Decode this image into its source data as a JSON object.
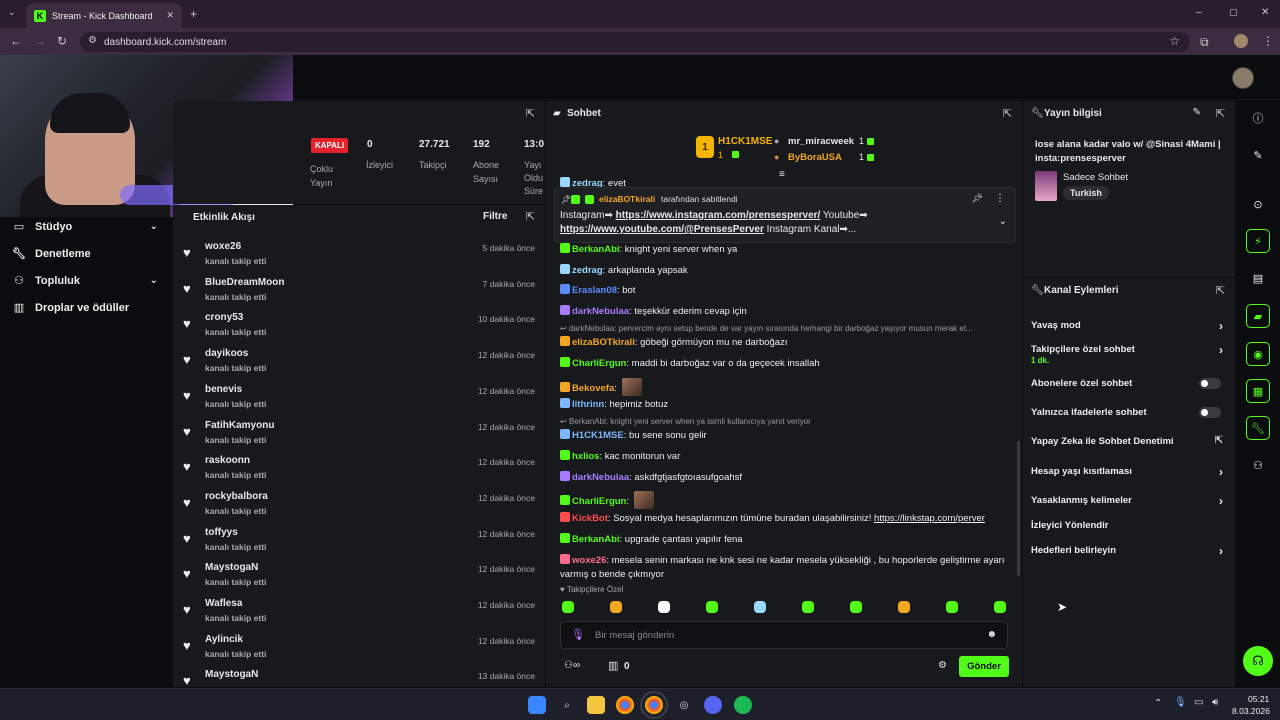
{
  "browser": {
    "tab_title": "Stream - Kick Dashboard",
    "new_tab": "+",
    "url": "dashboard.kick.com/stream",
    "window_controls": [
      "–",
      "▢",
      "✕"
    ]
  },
  "sidebar": {
    "items": [
      {
        "label": "Stüdyo",
        "icon": "tv-icon",
        "chevron": true
      },
      {
        "label": "Denetleme",
        "icon": "wrench-icon",
        "chevron": false
      },
      {
        "label": "Topluluk",
        "icon": "people-icon",
        "chevron": true
      },
      {
        "label": "Droplar ve ödüller",
        "icon": "gift-icon",
        "chevron": false
      }
    ]
  },
  "stats": {
    "status_badge": "KAPALI",
    "status_label_1": "Çoklu",
    "status_label_2": "Yayın",
    "viewers_value": "0",
    "viewers_label": "İzleyici",
    "followers_value": "27.721",
    "followers_label": "Takipçi",
    "subs_value": "192",
    "subs_label_1": "Abone",
    "subs_label_2": "Sayısı",
    "duration_value": "13:0",
    "duration_label_1": "Yayı",
    "duration_label_2": "Oldu",
    "duration_label_3": "Süre"
  },
  "activity": {
    "title": "Etkinlik Akışı",
    "filter_label": "Filtre",
    "items": [
      {
        "name": "woxe26",
        "sub": "kanalı takip etti",
        "time": "5 dakika önce"
      },
      {
        "name": "BlueDreamMoon",
        "sub": "kanalı takip etti",
        "time": "7 dakika önce"
      },
      {
        "name": "crony53",
        "sub": "kanalı takip etti",
        "time": "10 dakika önce"
      },
      {
        "name": "dayikoos",
        "sub": "kanalı takip etti",
        "time": "12 dakika önce"
      },
      {
        "name": "benevis",
        "sub": "kanalı takip etti",
        "time": "12 dakika önce"
      },
      {
        "name": "FatihKamyonu",
        "sub": "kanalı takip etti",
        "time": "12 dakika önce"
      },
      {
        "name": "raskoonn",
        "sub": "kanalı takip etti",
        "time": "12 dakika önce"
      },
      {
        "name": "rockybalbora",
        "sub": "kanalı takip etti",
        "time": "12 dakika önce"
      },
      {
        "name": "toffyys",
        "sub": "kanalı takip etti",
        "time": "12 dakika önce"
      },
      {
        "name": "MaystogaN",
        "sub": "kanalı takip etti",
        "time": "12 dakika önce"
      },
      {
        "name": "Waflesa",
        "sub": "kanalı takip etti",
        "time": "12 dakika önce"
      },
      {
        "name": "Aylincik",
        "sub": "kanalı takip etti",
        "time": "12 dakika önce"
      },
      {
        "name": "MaystogaN",
        "sub": "",
        "time": "13 dakika önce"
      }
    ]
  },
  "chat": {
    "title": "Sohbet",
    "top_gifters": [
      {
        "rank": "1",
        "name": "H1CK1MSE",
        "count": "1"
      },
      {
        "name": "mr_miracweek",
        "count": "1"
      },
      {
        "name": "ByBoraUSA",
        "count": "1"
      }
    ],
    "pinned": {
      "by_user": "elizaBOTkirali",
      "by_suffix": "tarafından sabitlendi",
      "line1_prefix": "Instagram➡",
      "line1_link": "https://www.instagram.com/prensesperver/",
      "line1_suffix": "Youtube➡",
      "line2_link": "https://www.youtube.com/@PrensesPerver",
      "line2_suffix": "Instagram Kanal➡..."
    },
    "messages": [
      {
        "user": "zedrag",
        "text": "evet",
        "color": "#9ad8ff",
        "partial": true
      },
      {
        "user": "BerkanAbi",
        "text": "knight yeni server when ya",
        "color": "#53fc18",
        "partial": true
      },
      {
        "user": "zedrag",
        "text": "arkaplanda yapsak",
        "color": "#9ad8ff"
      },
      {
        "user": "Eraslan08",
        "text": "bot",
        "color": "#5b8cff"
      },
      {
        "user": "darkNebulaa",
        "text": "teşekkür ederim cevap için",
        "color": "#a87cff"
      },
      {
        "reply": "darkNebulaa: pervercim aynı setup bende de var yayın sırasında herhangi bir darboğaz yaşıyor musun merak et..."
      },
      {
        "user": "elizaBOTkirali",
        "text": "göbeği görmüyon mu ne darboğazı",
        "color": "#f5a623"
      },
      {
        "user": "CharliErgun",
        "text": "maddi bi darboğaz var o da geçecek insallah",
        "color": "#53fc18"
      },
      {
        "user": "Bekovefa",
        "text": "",
        "color": "#f5a623"
      },
      {
        "user": "lithrinn",
        "text": "hepimiz botuz",
        "color": "#7fb7ff"
      },
      {
        "reply": "BerkanAbi: knight yeni server when ya isimli kullanıcıya yanıt veriyor"
      },
      {
        "user": "H1CK1MSE",
        "text": "bu sene sonu gelir",
        "color": "#7fb7ff"
      },
      {
        "user": "hxlios",
        "text": "kac monitorun var",
        "color": "#53fc18"
      },
      {
        "user": "darkNebulaa",
        "text": "askdfgtjasfgtoıasufgoahsf",
        "color": "#a87cff"
      },
      {
        "user": "CharliErgun",
        "text": "",
        "color": "#53fc18"
      },
      {
        "user": "KickBot",
        "text": "Sosyal medya hesaplarımızın tümüne buradan ulaşabilirsiniz!",
        "link": "https://linkstap.com/perver",
        "color": "#ff4d4d"
      },
      {
        "user": "BerkanAbi",
        "text": "upgrade çantası yapılır fena",
        "color": "#53fc18"
      },
      {
        "user": "woxe26",
        "text": "mesela senin markası ne knk sesi ne kadar mesela yüksekliği , bu hoporlerde geliştirme ayarı",
        "text2": "varmış o bende çıkmıyor",
        "color": "#ff6b8a"
      }
    ],
    "emote_label": "Takipçilere Özel",
    "input_placeholder": "Bir mesaj gönderin",
    "points_value": "0",
    "send_label": "Gönder"
  },
  "stream_info": {
    "title": "Yayın bilgisi",
    "description": "lose alana kadar valo w/ @Sinasi 4Mami | insta:prensesperver",
    "category": "Sadece Sohbet",
    "language_tag": "Turkish"
  },
  "channel_actions": {
    "title": "Kanal Eylemleri",
    "items": [
      {
        "label": "Yavaş mod",
        "kind": "chevron"
      },
      {
        "label": "Takipçilere özel sohbet",
        "sublabel": "1 dk.",
        "kind": "chevron"
      },
      {
        "label": "Abonelere özel sohbet",
        "kind": "toggle"
      },
      {
        "label": "Yalnızca ifadelerle sohbet",
        "kind": "toggle"
      },
      {
        "label": "Yapay Zeka ile Sohbet Denetimi",
        "kind": "external"
      },
      {
        "label": "Hesap yaşı kısıtlaması",
        "kind": "chevron"
      },
      {
        "label": "Yasaklanmış kelimeler",
        "kind": "chevron"
      },
      {
        "label": "İzleyici Yönlendir",
        "kind": "none"
      },
      {
        "label": "Hedefleri belirleyin",
        "kind": "chevron"
      }
    ]
  },
  "taskbar": {
    "time": "05:21",
    "date": "8.03.2026"
  },
  "colors": {
    "brand": "#53fc18",
    "panel": "#18191c",
    "bg": "#0b0c0e",
    "offline_badge": "#e3222b"
  }
}
